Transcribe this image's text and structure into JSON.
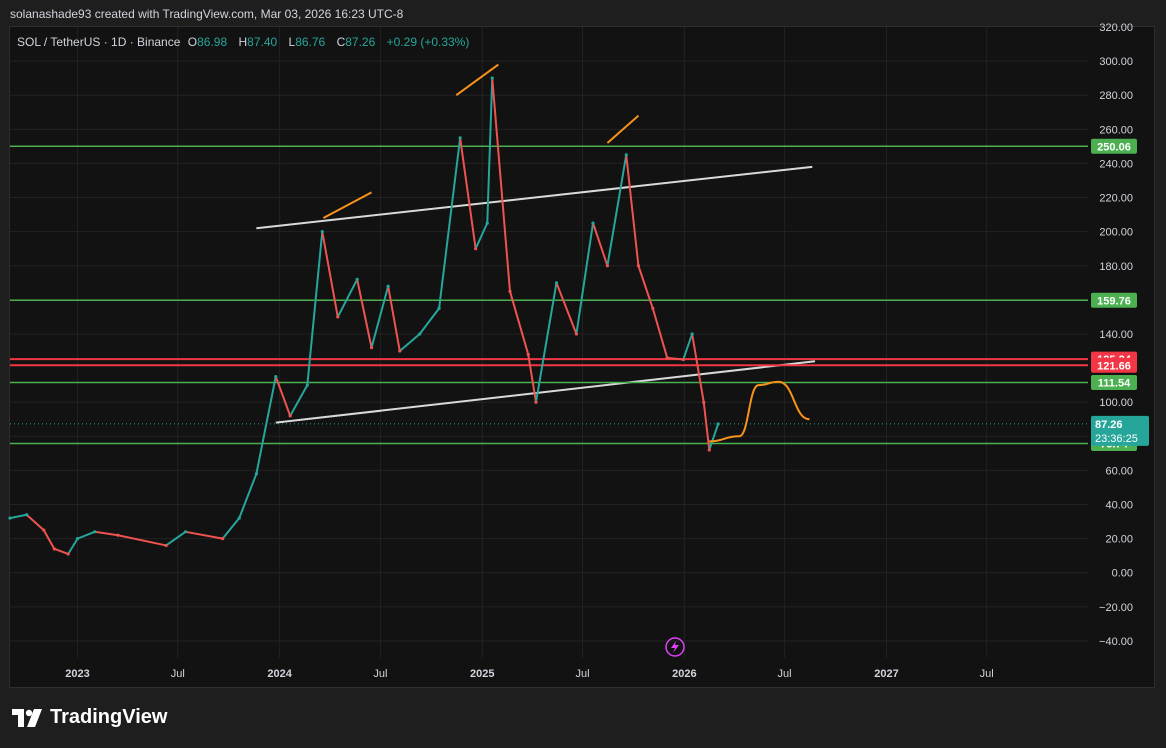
{
  "header": {
    "credit": "solanashade93 created with TradingView.com, Mar 03, 2026 16:23 UTC-8"
  },
  "symbol": {
    "name": "SOL / TetherUS · 1D · Binance",
    "open_key": "O",
    "open": "86.98",
    "high_key": "H",
    "high": "87.40",
    "low_key": "L",
    "low": "86.76",
    "close_key": "C",
    "close": "87.26",
    "change": "+0.29 (+0.33%)"
  },
  "footer": {
    "brand": "TradingView"
  },
  "colors": {
    "background": "#121212",
    "grid": "#222222",
    "axis_text": "#d1d4dc",
    "up": "#26a69a",
    "down": "#ef5350",
    "support": "#4caf50",
    "resistance": "#f23645",
    "trendline": "#d9d9d9",
    "annotation": "#f7931a"
  },
  "chart_data": {
    "type": "line",
    "title": "SOL / TetherUS · 1D · Binance",
    "xlabel": "",
    "ylabel": "",
    "x_range": [
      "2022-09-01",
      "2027-12-31"
    ],
    "ylim": [
      -50,
      320
    ],
    "y_ticks": [
      320,
      300,
      280,
      260,
      240,
      220,
      200,
      180,
      160,
      140,
      100,
      80,
      60,
      40,
      20,
      0,
      -20,
      -40
    ],
    "y_tick_labels": [
      "320.00",
      "300.00",
      "280.00",
      "260.00",
      "240.00",
      "220.00",
      "200.00",
      "180.00",
      "160.00",
      "140.00",
      "100.00",
      "80.00",
      "60.00",
      "40.00",
      "20.00",
      "0.00",
      "−20.00",
      "−40.00"
    ],
    "x_ticks": [
      {
        "date": "2023-01-01",
        "label": "2023"
      },
      {
        "date": "2023-07-01",
        "label": "Jul"
      },
      {
        "date": "2024-01-01",
        "label": "2024"
      },
      {
        "date": "2024-07-01",
        "label": "Jul"
      },
      {
        "date": "2025-01-01",
        "label": "2025"
      },
      {
        "date": "2025-07-01",
        "label": "Jul"
      },
      {
        "date": "2026-01-01",
        "label": "2026"
      },
      {
        "date": "2026-07-01",
        "label": "Jul"
      },
      {
        "date": "2027-01-01",
        "label": "2027"
      },
      {
        "date": "2027-07-01",
        "label": "Jul"
      }
    ],
    "series": [
      {
        "x": [
          "2022-09-01",
          "2022-10-01",
          "2022-11-01",
          "2022-11-20",
          "2022-12-15",
          "2023-01-01",
          "2023-02-01",
          "2023-03-15",
          "2023-06-10",
          "2023-07-15",
          "2023-09-20",
          "2023-10-20",
          "2023-11-20",
          "2023-12-25",
          "2024-01-20",
          "2024-02-20",
          "2024-03-18",
          "2024-04-15",
          "2024-05-20",
          "2024-06-15",
          "2024-07-15",
          "2024-08-05",
          "2024-09-10",
          "2024-10-15",
          "2024-11-22",
          "2024-12-20",
          "2025-01-10",
          "2025-01-19",
          "2025-02-20",
          "2025-03-25",
          "2025-04-08",
          "2025-05-15",
          "2025-06-20",
          "2025-07-20",
          "2025-08-15",
          "2025-09-18",
          "2025-10-10",
          "2025-11-05",
          "2025-12-01",
          "2025-12-30",
          "2026-01-15",
          "2026-02-05",
          "2026-02-15",
          "2026-03-03"
        ],
        "y": [
          32,
          34,
          25,
          14,
          11,
          20,
          24,
          22,
          16,
          24,
          20,
          32,
          58,
          115,
          92,
          110,
          200,
          150,
          172,
          132,
          168,
          130,
          140,
          155,
          255,
          190,
          205,
          290,
          165,
          128,
          100,
          170,
          140,
          205,
          180,
          245,
          180,
          155,
          126,
          125,
          140,
          100,
          72,
          87.26
        ]
      }
    ],
    "levels": [
      {
        "value": 250.06,
        "label": "250.06",
        "kind": "support"
      },
      {
        "value": 159.76,
        "label": "159.76",
        "kind": "support"
      },
      {
        "value": 125.24,
        "label": "125.24",
        "kind": "resistance"
      },
      {
        "value": 121.66,
        "label": "121.66",
        "kind": "resistance"
      },
      {
        "value": 111.54,
        "label": "111.54",
        "kind": "support"
      },
      {
        "value": 75.74,
        "label": "75.74",
        "kind": "support"
      }
    ],
    "last_price": {
      "value": 87.26,
      "label": "87.26",
      "countdown": "23:36:25"
    },
    "trendlines": [
      {
        "from": [
          "2023-11-20",
          202
        ],
        "to": [
          "2026-08-20",
          238
        ]
      },
      {
        "from": [
          "2023-12-25",
          88
        ],
        "to": [
          "2026-08-25",
          124
        ]
      }
    ],
    "annotations": [
      {
        "kind": "segment",
        "from": [
          "2024-03-20",
          208
        ],
        "to": [
          "2024-06-15",
          223
        ]
      },
      {
        "kind": "segment",
        "from": [
          "2024-11-15",
          280
        ],
        "to": [
          "2025-01-30",
          298
        ]
      },
      {
        "kind": "segment",
        "from": [
          "2025-08-15",
          252
        ],
        "to": [
          "2025-10-10",
          268
        ]
      },
      {
        "kind": "projection",
        "points": [
          [
            "2026-02-15",
            77
          ],
          [
            "2026-04-10",
            80
          ],
          [
            "2026-05-15",
            110
          ],
          [
            "2026-06-20",
            112
          ],
          [
            "2026-08-15",
            90
          ]
        ]
      }
    ],
    "grid": true,
    "legend": "none"
  }
}
